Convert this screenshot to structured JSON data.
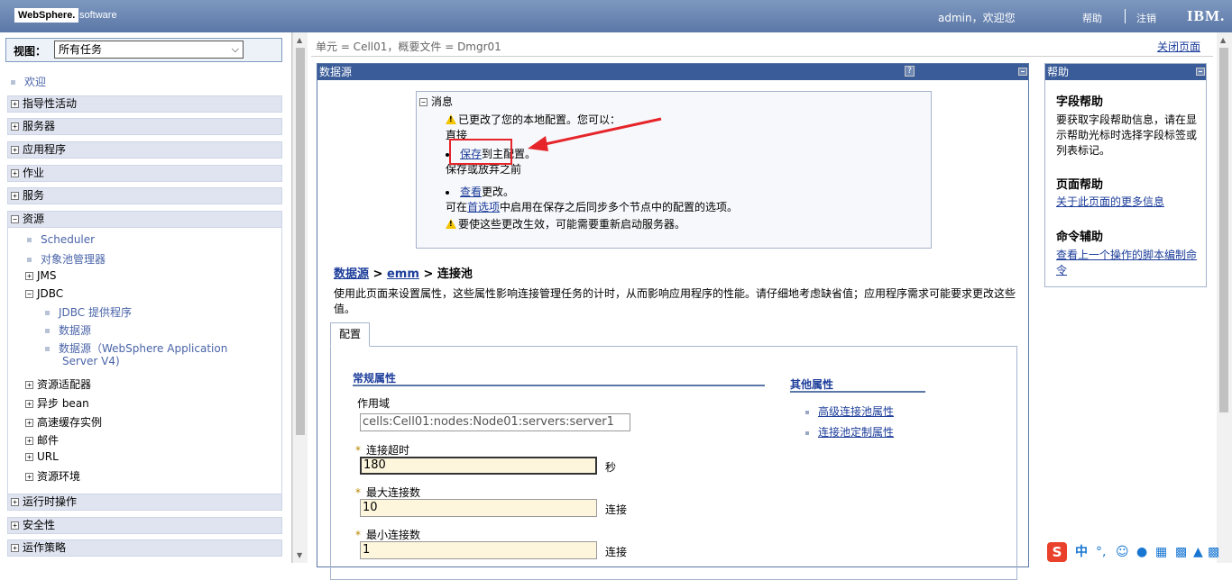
{
  "header": {
    "logo_text": "WebSphere.",
    "logo_sub": "software",
    "welcome": "admin，欢迎您",
    "help": "帮助",
    "logout": "注销",
    "ibm_logo": "IBM."
  },
  "nav": {
    "view_label": "视图：",
    "view_value": "所有任务",
    "welcome": "欢迎",
    "categories": {
      "guided": "指导性活动",
      "servers": "服务器",
      "applications": "应用程序",
      "jobs": "作业",
      "services": "服务",
      "resources": "资源",
      "runtime": "运行时操作",
      "security": "安全性",
      "policies": "运作策略"
    },
    "resources": {
      "scheduler": "Scheduler",
      "object_pool": "对象池管理器",
      "jms": "JMS",
      "jdbc": "JDBC",
      "jdbc_provider": "JDBC 提供程序",
      "datasource": "数据源",
      "datasource_v4_line1": "数据源（WebSphere Application",
      "datasource_v4_line2": "Server V4)",
      "resource_adapter": "资源适配器",
      "async_bean": "异步 bean",
      "cache": "高速缓存实例",
      "mail": "邮件",
      "url": "URL",
      "env": "资源环境"
    }
  },
  "main": {
    "breadcrumb": "单元 = Cell01，概要文件 = Dmgr01",
    "close_page": "关闭页面",
    "panel_title": "数据源",
    "messages": {
      "title": "消息",
      "line1": "已更改了您的本地配置。您可以：",
      "line2": "直接",
      "save": "保存",
      "save_rest": "到主配置。",
      "line4": "保存或放弃之前",
      "view": "查看",
      "view_rest": "更改。",
      "pref_pre": "可在",
      "pref_link": "首选项",
      "pref_post": "中启用在保存之后同步多个节点中的配置的选项。",
      "restart": "要使这些更改生效，可能需要重新启动服务器。"
    },
    "crumb": {
      "ds": "数据源",
      "sep": ">",
      "emm": "emm",
      "current": "连接池"
    },
    "description": "使用此页面来设置属性，这些属性影响连接管理任务的计时，从而影响应用程序的性能。请仔细地考虑缺省值；应用程序需求可能要求更改这些值。",
    "tab": "配置",
    "general_title": "常规属性",
    "scope_label": "作用域",
    "scope_value": "cells:Cell01:nodes:Node01:servers:server1",
    "conn_timeout_label": "连接超时",
    "conn_timeout_value": "180",
    "conn_timeout_unit": "秒",
    "max_conn_label": "最大连接数",
    "max_conn_value": "10",
    "max_conn_unit": "连接",
    "min_conn_label": "最小连接数",
    "min_conn_value": "1",
    "min_conn_unit": "连接",
    "req_marker": "*",
    "other_title": "其他属性",
    "other_links": {
      "adv": "高级连接池属性",
      "custom": "连接池定制属性"
    }
  },
  "help": {
    "title": "帮助",
    "field_h": "字段帮助",
    "field_p": "要获取字段帮助信息，请在显示帮助光标时选择字段标签或列表标记。",
    "page_h": "页面帮助",
    "page_link": "关于此页面的更多信息",
    "cmd_h": "命令辅助",
    "cmd_link": "查看上一个操作的脚本编制命令"
  },
  "ime": {
    "logo": "S",
    "lang": "中",
    "punct": "°,"
  },
  "colors": {
    "banner": "#5b77a7",
    "panel_title": "#3a5c98",
    "annotation": "#e5252a",
    "link": "#1c3d9a"
  }
}
